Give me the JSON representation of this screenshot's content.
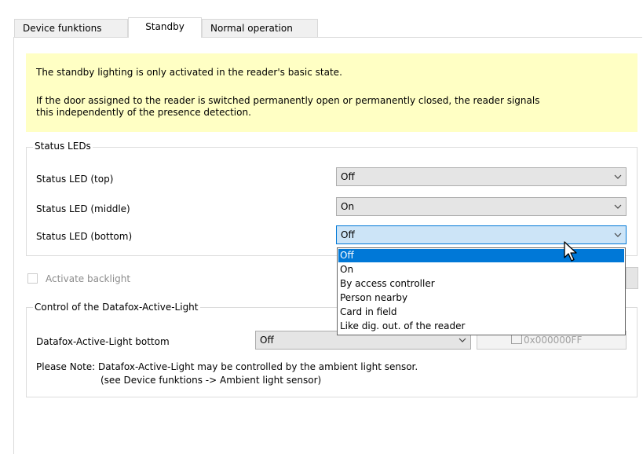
{
  "tabs": [
    "Device funktions",
    "Standby",
    "Normal operation"
  ],
  "info": {
    "line1": "The standby lighting is only activated in the reader's basic state.",
    "line2a": "If the door assigned to the reader is switched permanently open or permanently closed, the reader signals",
    "line2b": "this independently of the presence detection."
  },
  "status_leds": {
    "title": "Status LEDs",
    "rows": [
      {
        "label": "Status LED (top)",
        "value": "Off"
      },
      {
        "label": "Status LED (middle)",
        "value": "On"
      },
      {
        "label": "Status LED (bottom)",
        "value": "Off"
      }
    ]
  },
  "dropdown": {
    "options": [
      "Off",
      "On",
      "By access controller",
      "Person nearby",
      "Card in field",
      "Like dig. out. of the reader"
    ],
    "selected_index": 0
  },
  "backlight": {
    "label": "Activate backlight",
    "checked": false
  },
  "active_light": {
    "title": "Control of the Datafox-Active-Light",
    "label": "Datafox-Active-Light bottom",
    "value": "Off",
    "color_value": "0x000000FF",
    "note1": "Please Note: Datafox-Active-Light may be controlled by the ambient light sensor.",
    "note2": "(see Device funktions -> Ambient light sensor)"
  },
  "icons": {
    "chevron": "chevron-down-icon",
    "cursor": "mouse-pointer-icon"
  },
  "colors": {
    "note_bg": "#ffffc4",
    "focus_bg": "#cce4f7",
    "selection": "#0078d7"
  }
}
